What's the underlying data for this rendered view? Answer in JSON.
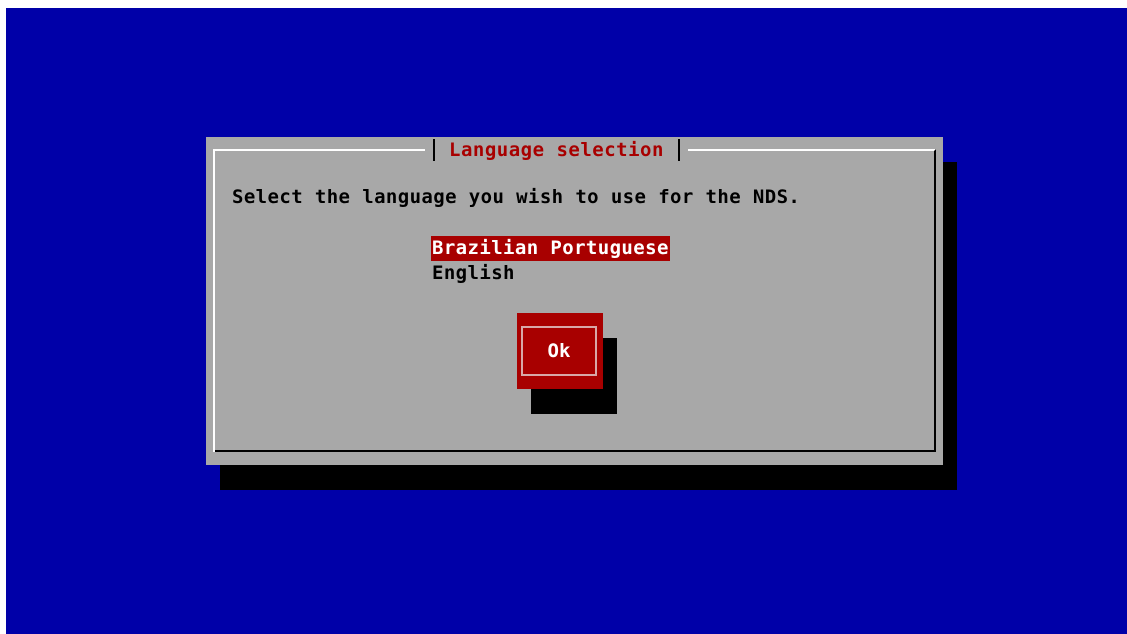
{
  "dialog": {
    "title": "Language selection",
    "prompt": "Select the language you wish to use for the NDS.",
    "options": [
      {
        "label": "Brazilian Portuguese",
        "selected": true
      },
      {
        "label": "English",
        "selected": false
      }
    ],
    "ok_label": "Ok"
  },
  "colors": {
    "background": "#0000a8",
    "dialog": "#a8a8a8",
    "accent": "#a80000",
    "shadow": "#000000"
  }
}
